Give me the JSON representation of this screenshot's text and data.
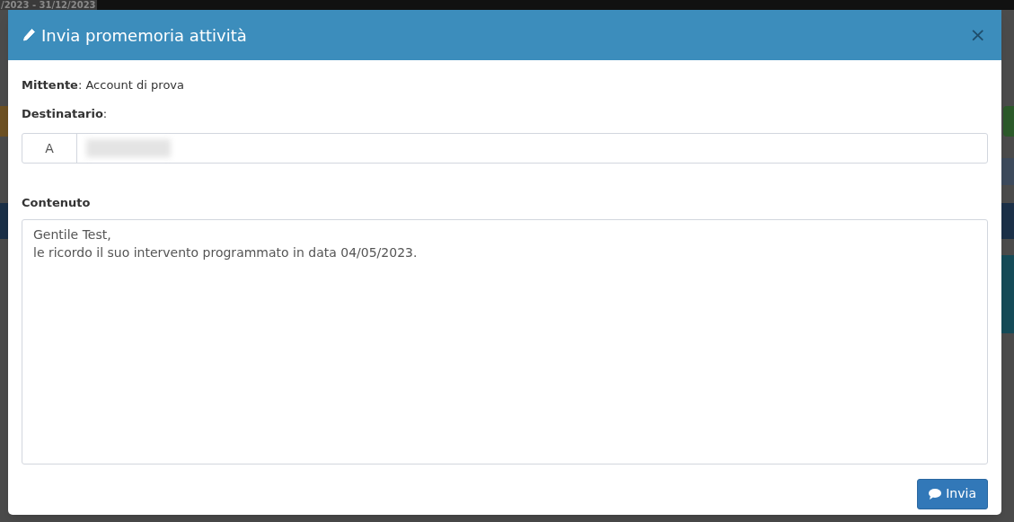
{
  "background_page": {
    "date_range": "/2023 - 31/12/2023"
  },
  "modal": {
    "title": "Invia promemoria attività",
    "close": "×",
    "sender": {
      "text": "**Mittente**: Account di prova"
    },
    "recipient": {
      "label": "**Destinatario**:",
      "prefix": "A"
    },
    "content": {
      "label": "Contenuto",
      "value": "Gentile Test,\nle ricordo il suo intervento programmato in data 04/05/2023."
    },
    "send_button": "Invia"
  }
}
